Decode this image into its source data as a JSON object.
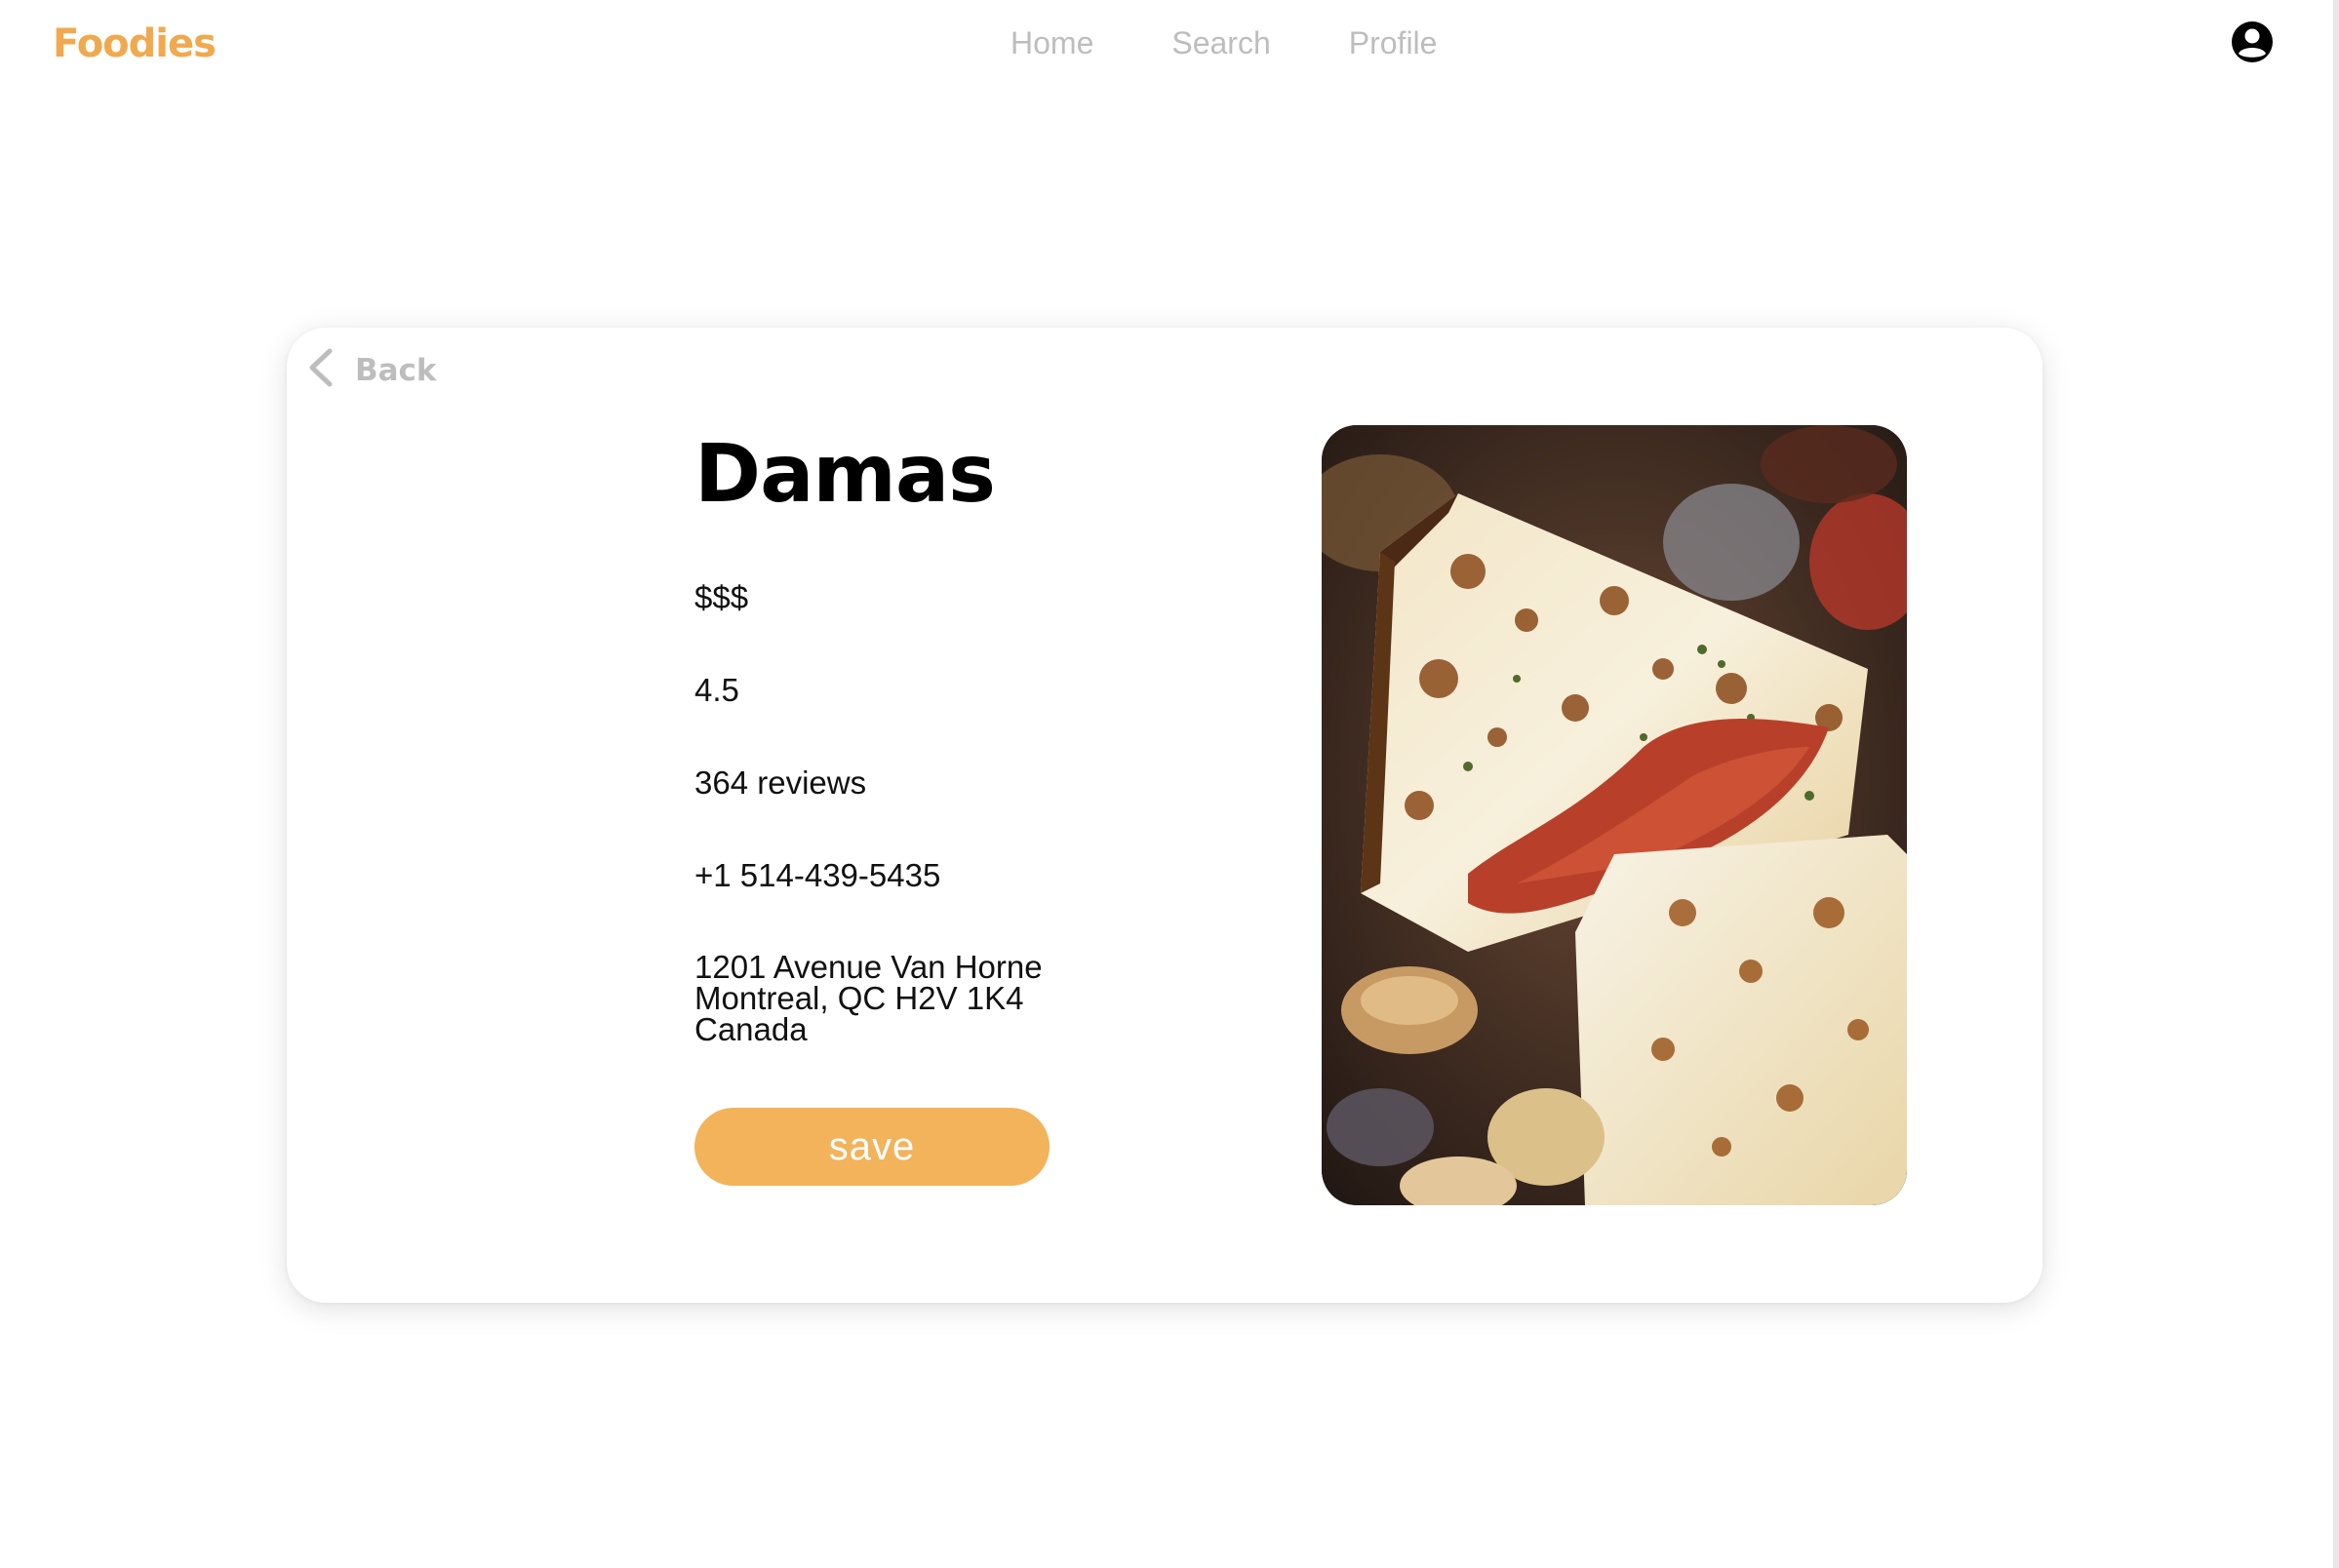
{
  "header": {
    "brand": "Foodies",
    "nav": [
      "Home",
      "Search",
      "Profile"
    ],
    "avatar_icon": "user-circle-icon"
  },
  "card": {
    "back_label": "Back",
    "back_icon": "chevron-left-icon",
    "restaurant": {
      "name": "Damas",
      "price": "$$$",
      "rating": "4.5",
      "reviews": "364 reviews",
      "phone": "+1 514-439-5435",
      "address": [
        "1201 Avenue Van Horne",
        "Montreal, QC H2V 1K4",
        "Canada"
      ]
    },
    "save_label": "save",
    "photo_subject": "grilled halloumi with mushrooms"
  },
  "colors": {
    "brand": "#F0A94E",
    "button": "#F2B35A",
    "nav_text": "#bdbdbd"
  }
}
